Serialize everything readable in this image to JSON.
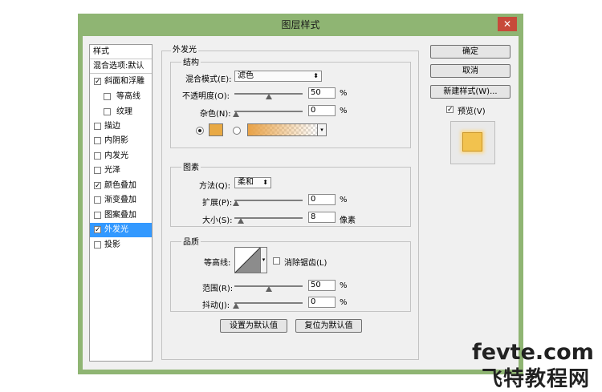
{
  "window": {
    "title": "图层样式",
    "close_glyph": "✕"
  },
  "styles_panel": {
    "header": "样式",
    "blend_default": "混合选项:默认",
    "items": [
      {
        "label": "斜面和浮雕",
        "checked": true
      },
      {
        "label": "等高线",
        "checked": false
      },
      {
        "label": "纹理",
        "checked": false
      },
      {
        "label": "描边",
        "checked": false
      },
      {
        "label": "内阴影",
        "checked": false
      },
      {
        "label": "内发光",
        "checked": false
      },
      {
        "label": "光泽",
        "checked": false
      },
      {
        "label": "颜色叠加",
        "checked": true
      },
      {
        "label": "渐变叠加",
        "checked": false
      },
      {
        "label": "图案叠加",
        "checked": false
      },
      {
        "label": "外发光",
        "checked": true,
        "selected": true
      },
      {
        "label": "投影",
        "checked": false
      }
    ],
    "check_glyph": "✓"
  },
  "outer_glow": {
    "section_title": "外发光",
    "structure": {
      "title": "结构",
      "blend_mode_label": "混合模式(E):",
      "blend_mode_value": "滤色",
      "opacity_label": "不透明度(O):",
      "opacity_value": "50",
      "noise_label": "杂色(N):",
      "noise_value": "0",
      "percent": "%",
      "glow_color": "#e8a944",
      "dropdown_glyph": "▾"
    },
    "elements": {
      "title": "图素",
      "method_label": "方法(Q):",
      "method_value": "柔和",
      "spread_label": "扩展(P):",
      "spread_value": "0",
      "size_label": "大小(S):",
      "size_value": "8",
      "percent": "%",
      "pixels": "像素"
    },
    "quality": {
      "title": "品质",
      "contour_label": "等高线:",
      "antialias_label": "消除锯齿(L)",
      "range_label": "范围(R):",
      "range_value": "50",
      "jitter_label": "抖动(J):",
      "jitter_value": "0",
      "percent": "%"
    },
    "make_default": "设置为默认值",
    "reset_default": "复位为默认值"
  },
  "side_buttons": {
    "ok": "确定",
    "cancel": "取消",
    "new_style": "新建样式(W)...",
    "preview_label": "预览(V)",
    "preview_checked": true
  },
  "watermark": {
    "line1": "fevte.com",
    "line2": "飞特教程网"
  }
}
